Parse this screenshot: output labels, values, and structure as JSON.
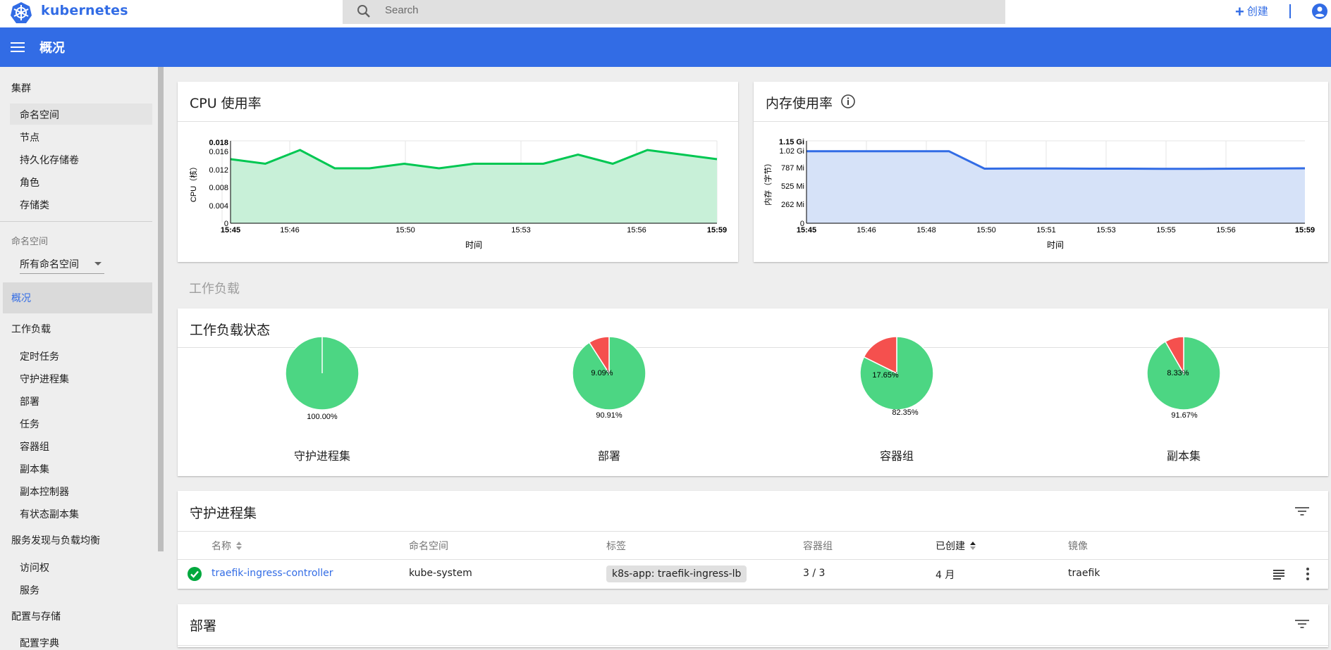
{
  "app": {
    "brand": "kubernetes",
    "search_placeholder": "Search",
    "create_label": "创建"
  },
  "header": {
    "title": "概况"
  },
  "sidebar": {
    "cluster_heading": "集群",
    "cluster_items": [
      "命名空间",
      "节点",
      "持久化存储卷",
      "角色",
      "存储类"
    ],
    "namespace_label": "命名空间",
    "namespace_selected": "所有命名空间",
    "overview_label": "概况",
    "workloads_heading": "工作负载",
    "workload_items": [
      "定时任务",
      "守护进程集",
      "部署",
      "任务",
      "容器组",
      "副本集",
      "副本控制器",
      "有状态副本集"
    ],
    "discovery_heading": "服务发现与负载均衡",
    "discovery_items": [
      "访问权",
      "服务"
    ],
    "config_heading": "配置与存储",
    "config_items": [
      "配置字典"
    ]
  },
  "cpu_card": {
    "title": "CPU 使用率"
  },
  "mem_card": {
    "title": "内存使用率"
  },
  "workloads_section": "工作负载",
  "workload_status": {
    "title": "工作负载状态",
    "pies": [
      {
        "label": "守护进程集",
        "running_text": "100.00%",
        "failed_text": "",
        "running_pct": 100.0,
        "failed_pct": 0
      },
      {
        "label": "部署",
        "running_text": "90.91%",
        "failed_text": "9.09%",
        "running_pct": 90.91,
        "failed_pct": 9.09
      },
      {
        "label": "容器组",
        "running_text": "82.35%",
        "failed_text": "17.65%",
        "running_pct": 82.35,
        "failed_pct": 17.65
      },
      {
        "label": "副本集",
        "running_text": "91.67%",
        "failed_text": "8.33%",
        "running_pct": 91.67,
        "failed_pct": 8.33
      }
    ],
    "colors": {
      "running": "#4cd683",
      "failed": "#f5504e"
    }
  },
  "daemonsets": {
    "title": "守护进程集",
    "columns": [
      "名称",
      "命名空间",
      "标签",
      "容器组",
      "已创建",
      "镜像"
    ],
    "rows": [
      {
        "name": "traefik-ingress-controller",
        "namespace": "kube-system",
        "label": "k8s-app: traefik-ingress-lb",
        "pods": "3 / 3",
        "created": "4 月",
        "image": "traefik"
      }
    ]
  },
  "deployments": {
    "title": "部署"
  },
  "colors": {
    "brand": "#326ce5",
    "cpu_line": "#00c752",
    "cpu_fill": "#c8f0d8",
    "mem_line": "#326ce5",
    "mem_fill": "#d6e2f8"
  },
  "chart_data": [
    {
      "type": "area",
      "title": "",
      "xlabel": "时间",
      "ylabel": "CPU（核）",
      "x_tick_labels": [
        "15:45",
        "15:46",
        "15:50",
        "15:53",
        "15:56",
        "15:59"
      ],
      "y_tick_labels": [
        "0",
        "0.004",
        "0.008",
        "0.012",
        "0.016",
        "0.018"
      ],
      "ylim": [
        0,
        0.018
      ],
      "series": [
        {
          "values": [
            0.014,
            0.013,
            0.016,
            0.012,
            0.012,
            0.013,
            0.012,
            0.013,
            0.013,
            0.013,
            0.015,
            0.013,
            0.016,
            0.015,
            0.014
          ]
        }
      ]
    },
    {
      "type": "area",
      "title": "",
      "xlabel": "时间",
      "ylabel": "内存（字节）",
      "x_tick_labels": [
        "15:45",
        "15:46",
        "15:48",
        "15:50",
        "15:51",
        "15:53",
        "15:55",
        "15:56",
        "15:59"
      ],
      "y_tick_labels": [
        "0",
        "262 Mi",
        "525 Mi",
        "787 Mi",
        "1.02 Gi",
        "1.15 Gi"
      ],
      "y_unit": "Mi",
      "ylim": [
        0,
        1177.6
      ],
      "series": [
        {
          "values": [
            1030,
            1030,
            1030,
            1030,
            1030,
            780,
            782,
            782,
            780,
            780,
            778,
            778,
            780,
            782,
            785
          ]
        }
      ]
    }
  ]
}
